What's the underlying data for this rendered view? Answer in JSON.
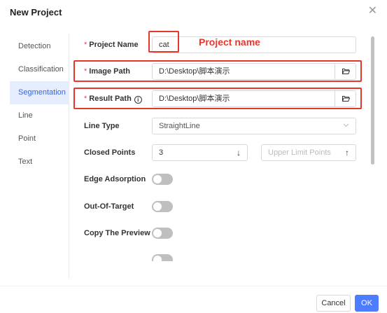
{
  "dialog": {
    "title": "New Project",
    "close_icon": "close-icon"
  },
  "nav": {
    "items": [
      {
        "label": "Detection",
        "active": false
      },
      {
        "label": "Classification",
        "active": false
      },
      {
        "label": "Segmentation",
        "active": true
      },
      {
        "label": "Line",
        "active": false
      },
      {
        "label": "Point",
        "active": false
      },
      {
        "label": "Text",
        "active": false
      }
    ]
  },
  "form": {
    "project_name": {
      "label": "Project Name",
      "required": "*",
      "value": "cat"
    },
    "image_path": {
      "label": "Image Path",
      "required": "*",
      "value": "D:\\Desktop\\脚本演示",
      "icon": "folder-open-icon"
    },
    "result_path": {
      "label": "Result Path",
      "required": "*",
      "info_icon": "i",
      "value": "D:\\Desktop\\脚本演示",
      "icon": "folder-open-icon"
    },
    "line_type": {
      "label": "Line Type",
      "value": "StraightLine",
      "icon": "chevron-down-icon"
    },
    "closed_points": {
      "label": "Closed Points",
      "value": "3",
      "down_arrow": "↓",
      "upper_placeholder": "Upper Limit Points",
      "up_arrow": "↑"
    },
    "edge_adsorption": {
      "label": "Edge Adsorption",
      "on": false
    },
    "out_of_target": {
      "label": "Out-Of-Target",
      "on": false
    },
    "copy_preview": {
      "label": "Copy The Preview",
      "on": false
    }
  },
  "annotation": {
    "text": "Project name",
    "color": "#e8362d"
  },
  "footer": {
    "cancel_label": "Cancel",
    "ok_label": "OK"
  },
  "colors": {
    "accent": "#4d7cfe",
    "nav_active_bg": "#e6edff",
    "nav_active_text": "#3b63d9",
    "toggle_off": "#bfbfbf"
  }
}
